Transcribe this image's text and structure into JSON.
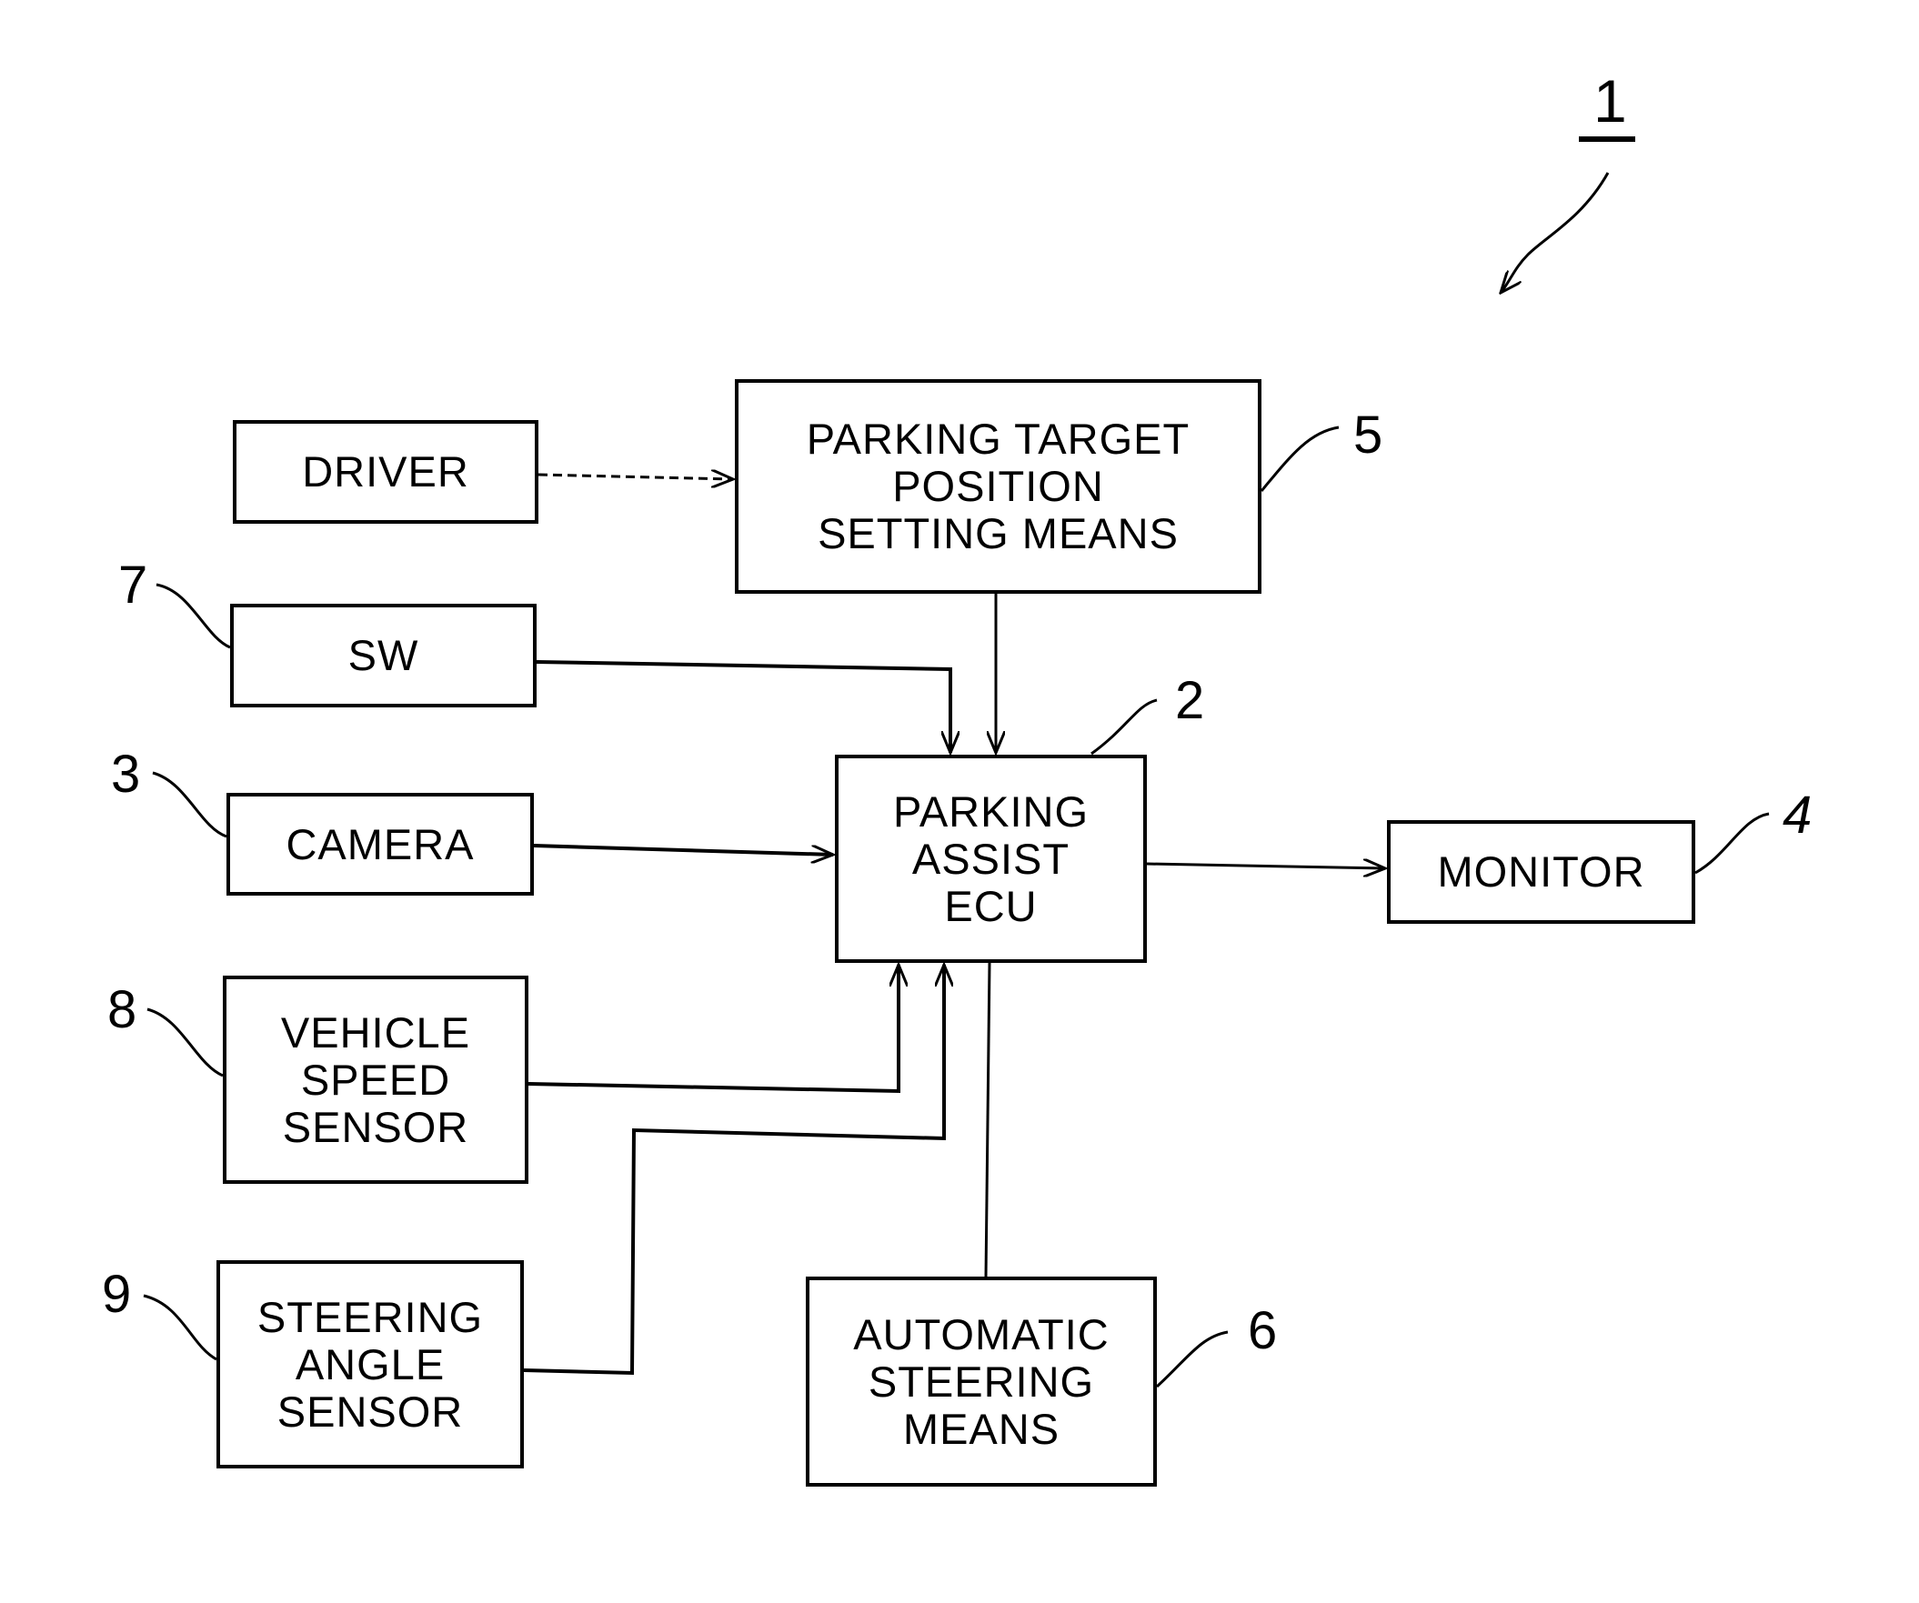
{
  "figure": {
    "reference": "1",
    "blocks": {
      "driver": {
        "lines": [
          "DRIVER"
        ]
      },
      "parking_target": {
        "ref": "5",
        "lines": [
          "PARKING TARGET",
          "POSITION",
          "SETTING MEANS"
        ]
      },
      "sw": {
        "ref": "7",
        "lines": [
          "SW"
        ]
      },
      "ecu": {
        "ref": "2",
        "lines": [
          "PARKING",
          "ASSIST",
          "ECU"
        ]
      },
      "camera": {
        "ref": "3",
        "lines": [
          "CAMERA"
        ]
      },
      "monitor": {
        "ref": "4",
        "lines": [
          "MONITOR"
        ]
      },
      "vehicle_speed": {
        "ref": "8",
        "lines": [
          "VEHICLE",
          "SPEED",
          "SENSOR"
        ]
      },
      "steering_angle": {
        "ref": "9",
        "lines": [
          "STEERING",
          "ANGLE",
          "SENSOR"
        ]
      },
      "auto_steering": {
        "ref": "6",
        "lines": [
          "AUTOMATIC",
          "STEERING",
          "MEANS"
        ]
      }
    },
    "connections": [
      {
        "from": "driver",
        "to": "parking_target",
        "style": "dashed"
      },
      {
        "from": "parking_target",
        "to": "ecu",
        "style": "solid"
      },
      {
        "from": "sw",
        "to": "ecu",
        "style": "solid"
      },
      {
        "from": "camera",
        "to": "ecu",
        "style": "solid"
      },
      {
        "from": "ecu",
        "to": "monitor",
        "style": "solid"
      },
      {
        "from": "vehicle_speed",
        "to": "ecu",
        "style": "solid"
      },
      {
        "from": "steering_angle",
        "to": "ecu",
        "style": "solid"
      },
      {
        "from": "ecu",
        "to": "auto_steering",
        "style": "line"
      }
    ]
  }
}
